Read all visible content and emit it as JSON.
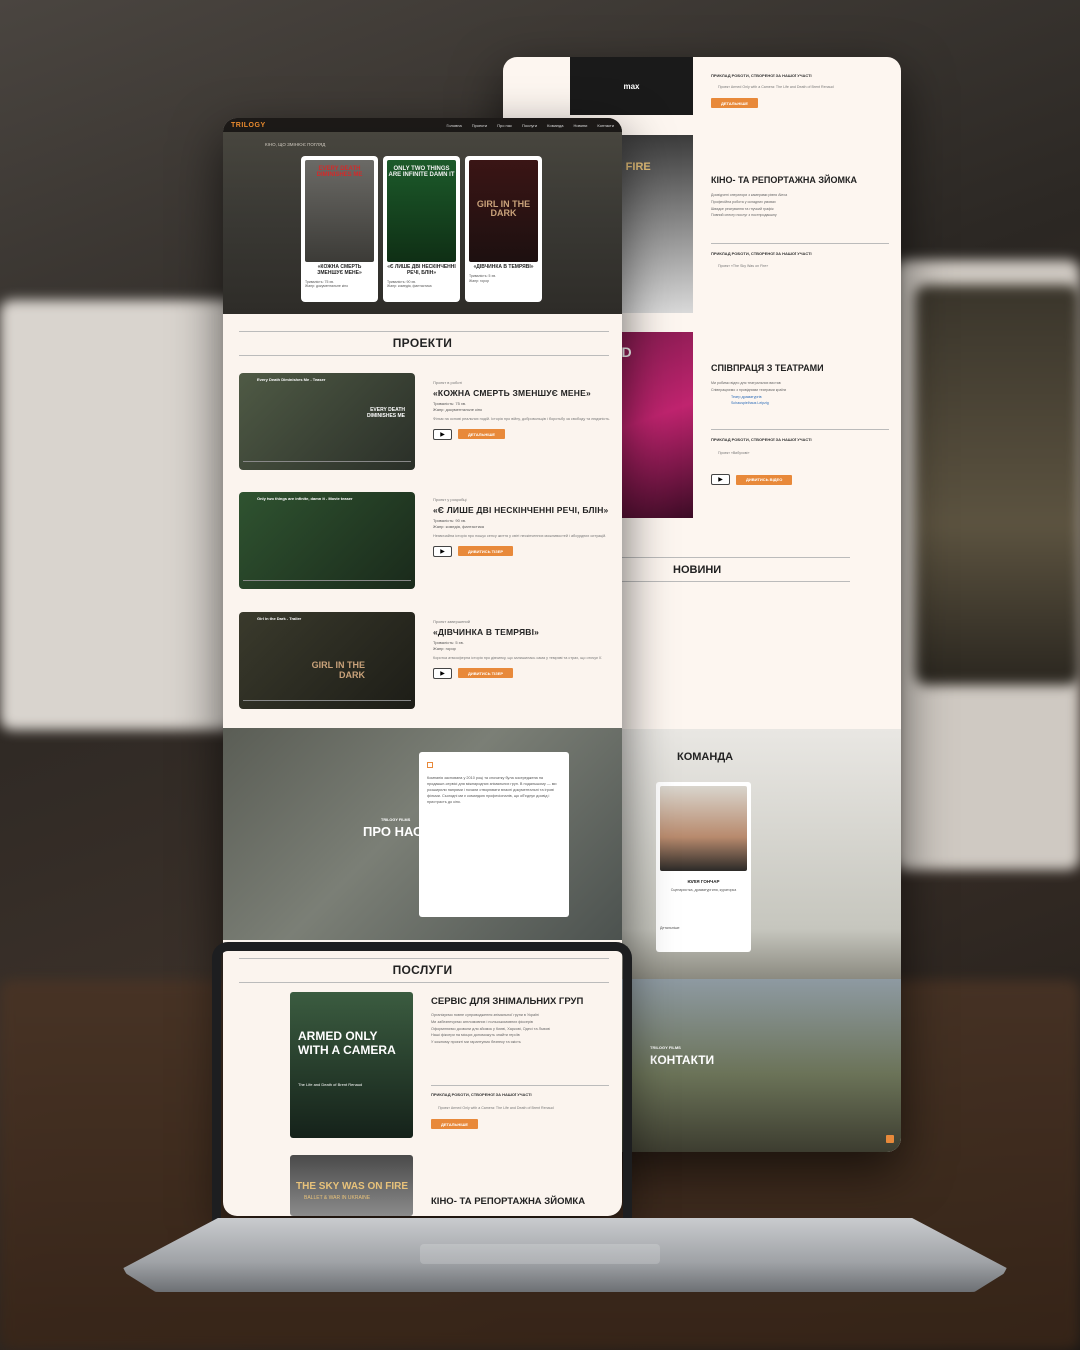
{
  "nav": {
    "logo": "TRILOGY",
    "items": [
      "Головна",
      "Проекти",
      "Про нас",
      "Послуги",
      "Команда",
      "Новини",
      "Контакти"
    ]
  },
  "hero": {
    "tagline": "КІНО, ЩО ЗМІНЮЄ ПОГЛЯД",
    "cards": [
      {
        "poster_text": "EVERY DEATH DIMINISHES ME",
        "title": "«КОЖНА СМЕРТЬ ЗМЕНШУЄ МЕНЕ»",
        "duration": "Тривалість: 75 хв.",
        "genre": "Жанр: документальне кіно"
      },
      {
        "poster_text": "ONLY TWO THINGS ARE INFINITE DAMN IT",
        "title": "«Є ЛИШЕ ДВІ НЕСКІНЧЕННІ РЕЧІ, БЛІН»",
        "duration": "Тривалість: 90 хв.",
        "genre": "Жанр: комедія, фантастика"
      },
      {
        "poster_text": "GIRL IN THE DARK",
        "title": "«ДІВЧИНКА В ТЕМРЯВІ»",
        "duration": "Тривалість: 5 хв.",
        "genre": "Жанр: горор"
      }
    ]
  },
  "projects": {
    "title": "ПРОЕКТИ",
    "items": [
      {
        "video_title": "Every Death Diminishes Me - Teaser",
        "video_big": "EVERY DEATH DIMINISHES ME",
        "label": "Проект в роботі",
        "title": "«КОЖНА СМЕРТЬ ЗМЕНШУЄ МЕНЕ»",
        "duration": "Тривалість: 75 хв.",
        "genre": "Жанр: документальне кіно",
        "desc": "Фільм на основі реальних подій. Історія про війну, добровольців і боротьбу за свободу та людяність.",
        "button": "ДЕТАЛЬНІШЕ"
      },
      {
        "video_title": "Only two things are infinite, damn it - Movie teaser",
        "video_big": "",
        "label": "Проект у розробці",
        "title": "«Є ЛИШЕ ДВІ НЕСКІНЧЕННІ РЕЧІ, БЛІН»",
        "duration": "Тривалість: 90 хв.",
        "genre": "Жанр: комедія, фантастика",
        "desc": "Незвичайна історія про пошук сенсу життя у світі нескінченних можливостей і абсурдних ситуацій.",
        "button": "ДИВИТИСЬ ТІЗЕР"
      },
      {
        "video_title": "Girl in the Dark - Trailer",
        "video_big": "GIRL IN THE DARK",
        "label": "Проект завершений",
        "title": "«ДІВЧИНКА В ТЕМРЯВІ»",
        "duration": "Тривалість: 5 хв.",
        "genre": "Жанр: горор",
        "desc": "Коротка атмосферна історія про дівчинку, що залишилась сама у темряві та страх, що оточує її.",
        "button": "ДИВИТИСЬ ТІЗЕР"
      }
    ]
  },
  "about": {
    "brand": "TRILOGY FILMS",
    "title": "ПРО НАС",
    "text": "Компанія заснована у 2010 році та спочатку була зосереджена на продакшн-сервісі для міжнародних знімальних груп. В подальшому — ми розширили напрями і почали створювати власні документальні та ігрові фільми. Сьогодні ми є командою професіоналів, що об'єднує досвід і пристрасть до кіно."
  },
  "services": {
    "title": "ПОСЛУГИ",
    "items": [
      {
        "poster": "ARMED ONLY WITH A CAMERA",
        "poster_sub": "The Life and Death of Brent Renaud",
        "title": "СЕРВІС ДЛЯ ЗНІМАЛЬНИХ ГРУП",
        "list": [
          "Організуємо повне супроводження знімальної групи в Україні",
          "Ми забезпечуємо англомовних і польськомовних фіксерів",
          "Оформлюємо дозволи для зйомок у Києві, Харкові, Одесі та Львові",
          "Наші фіксери на місцях допоможуть знайти героїв",
          "У кожному проєкті ми гарантуємо безпеку та якість"
        ],
        "example_label": "ПРИКЛАД РОБОТИ, СТВОРЕНОЇ ЗА НАШОЇ УЧАСТІ",
        "example": "Проект Armed Only with a Camera: The Life and Death of Brent Renaud",
        "button": "ДЕТАЛЬНІШЕ"
      },
      {
        "poster": "THE SKY WAS ON FIRE",
        "poster_sub": "BALLET & WAR IN UKRAINE",
        "title": "КІНО- ТА РЕПОРТАЖНА ЗЙОМКА"
      }
    ]
  },
  "back": {
    "example_label": "ПРИКЛАД РОБОТИ, СТВОРЕНОЇ ЗА НАШОЇ УЧАСТІ",
    "example": "Проект Armed Only with a Camera: The Life and Death of Brent Renaud",
    "button": "ДЕТАЛЬНІШЕ",
    "reportage_title": "КІНО- ТА РЕПОРТАЖНА ЗЙОМКА",
    "reportage_list": [
      "Досвідчені оператори з камерами рівня Alexa",
      "Професійна робота у складних умовах",
      "Швидке реагування та гнучкий графік",
      "Повний спектр послуг з постпродакшну"
    ],
    "reportage_example": "Проект «The Sky Was on Fire»",
    "theatre_title": "СПІВПРАЦЯ З ТЕАТРАМИ",
    "theatre_list": [
      "Ми робимо відео для театральних вистав",
      "Співпрацюємо з провідними театрами країни"
    ],
    "theatre_links": [
      "Театр драматургів",
      "Schauspielhaus Leipzig"
    ],
    "theatre_example": "Проект «Вибухові»",
    "theatre_button": "ДИВИТИСЬ ВІДЕО",
    "news_title": "НОВИНИ",
    "team_title": "КОМАНДА",
    "member_name": "ЮЛІЯ ГОНЧАР",
    "member_role": "Сценаристка, драматургиня, кураторка",
    "member_link": "Детальніше",
    "contacts_brand": "TRILOGY FILMS",
    "contacts_title": "КОНТАКТИ"
  }
}
